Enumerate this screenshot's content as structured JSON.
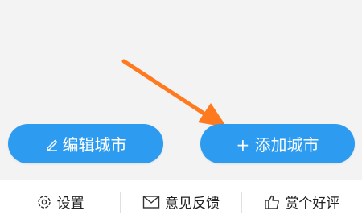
{
  "buttons": {
    "edit_city": "编辑城市",
    "add_city": "+ 添加城市"
  },
  "toolbar": {
    "settings": "设置",
    "feedback": "意见反馈",
    "rate": "赏个好评"
  },
  "icons": {
    "edit": "pencil-icon",
    "settings": "gear-icon",
    "feedback": "envelope-icon",
    "rate": "thumbs-up-icon",
    "annotation": "arrow-icon"
  },
  "colors": {
    "button_blue": "#2d9cf0",
    "arrow_orange": "#ff7a1f",
    "background": "#f3f3f3",
    "toolbar_bg": "#ffffff"
  }
}
